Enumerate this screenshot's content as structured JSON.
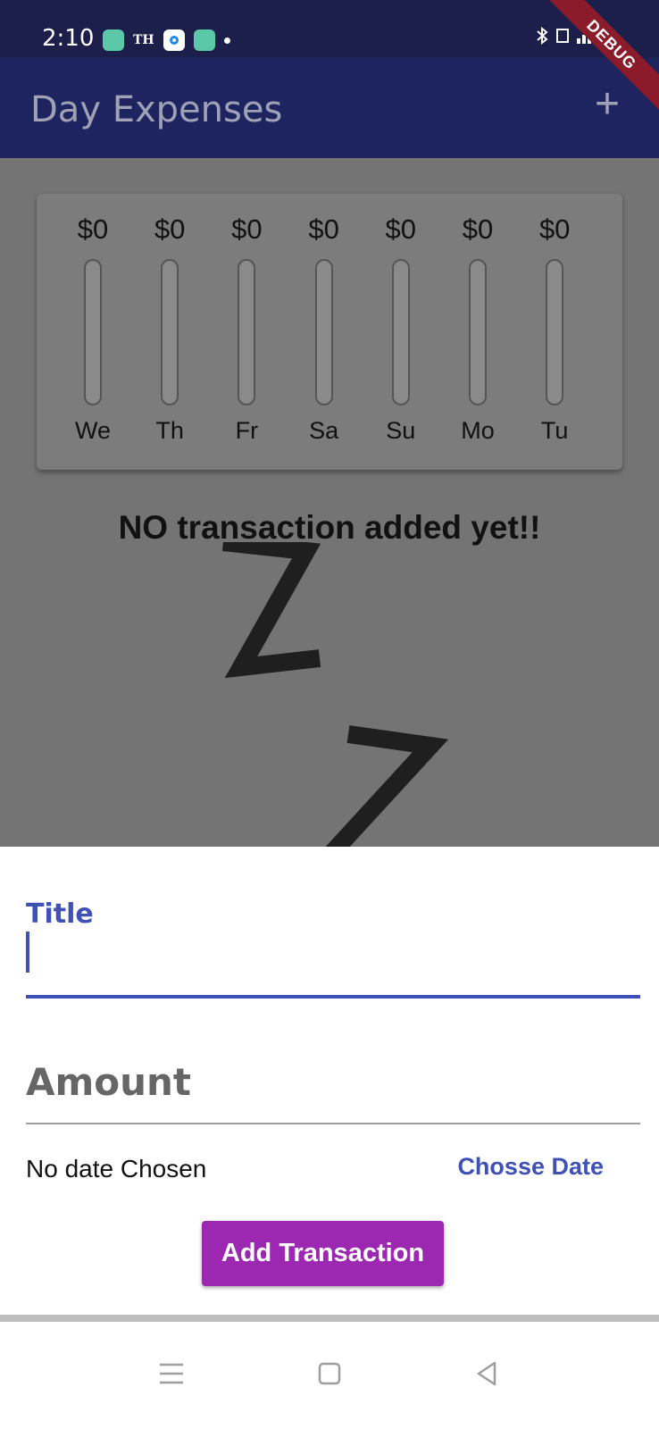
{
  "status_bar": {
    "time": "2:10",
    "th_label": "TH",
    "debug_label": "DEBUG"
  },
  "app_bar": {
    "title": "Day Expenses",
    "add_icon": "+"
  },
  "chart": {
    "bars": [
      {
        "amount": "$0",
        "day": "We",
        "fill": 0
      },
      {
        "amount": "$0",
        "day": "Th",
        "fill": 0
      },
      {
        "amount": "$0",
        "day": "Fr",
        "fill": 0
      },
      {
        "amount": "$0",
        "day": "Sa",
        "fill": 0
      },
      {
        "amount": "$0",
        "day": "Su",
        "fill": 0
      },
      {
        "amount": "$0",
        "day": "Mo",
        "fill": 0
      },
      {
        "amount": "$0",
        "day": "Tu",
        "fill": 0
      }
    ]
  },
  "empty_state": {
    "message": "NO transaction added yet!!",
    "image_icon": "sleeping-zz-icon"
  },
  "form": {
    "title_label": "Title",
    "title_value": "",
    "amount_placeholder": "Amount",
    "date_text": "No date Chosen",
    "choose_date_label": "Chosse Date",
    "submit_label": "Add Transaction"
  },
  "colors": {
    "primary": "#3f51b5",
    "accent": "#9c27b0",
    "app_bar": "#1e2460",
    "overlay": "#747474"
  }
}
